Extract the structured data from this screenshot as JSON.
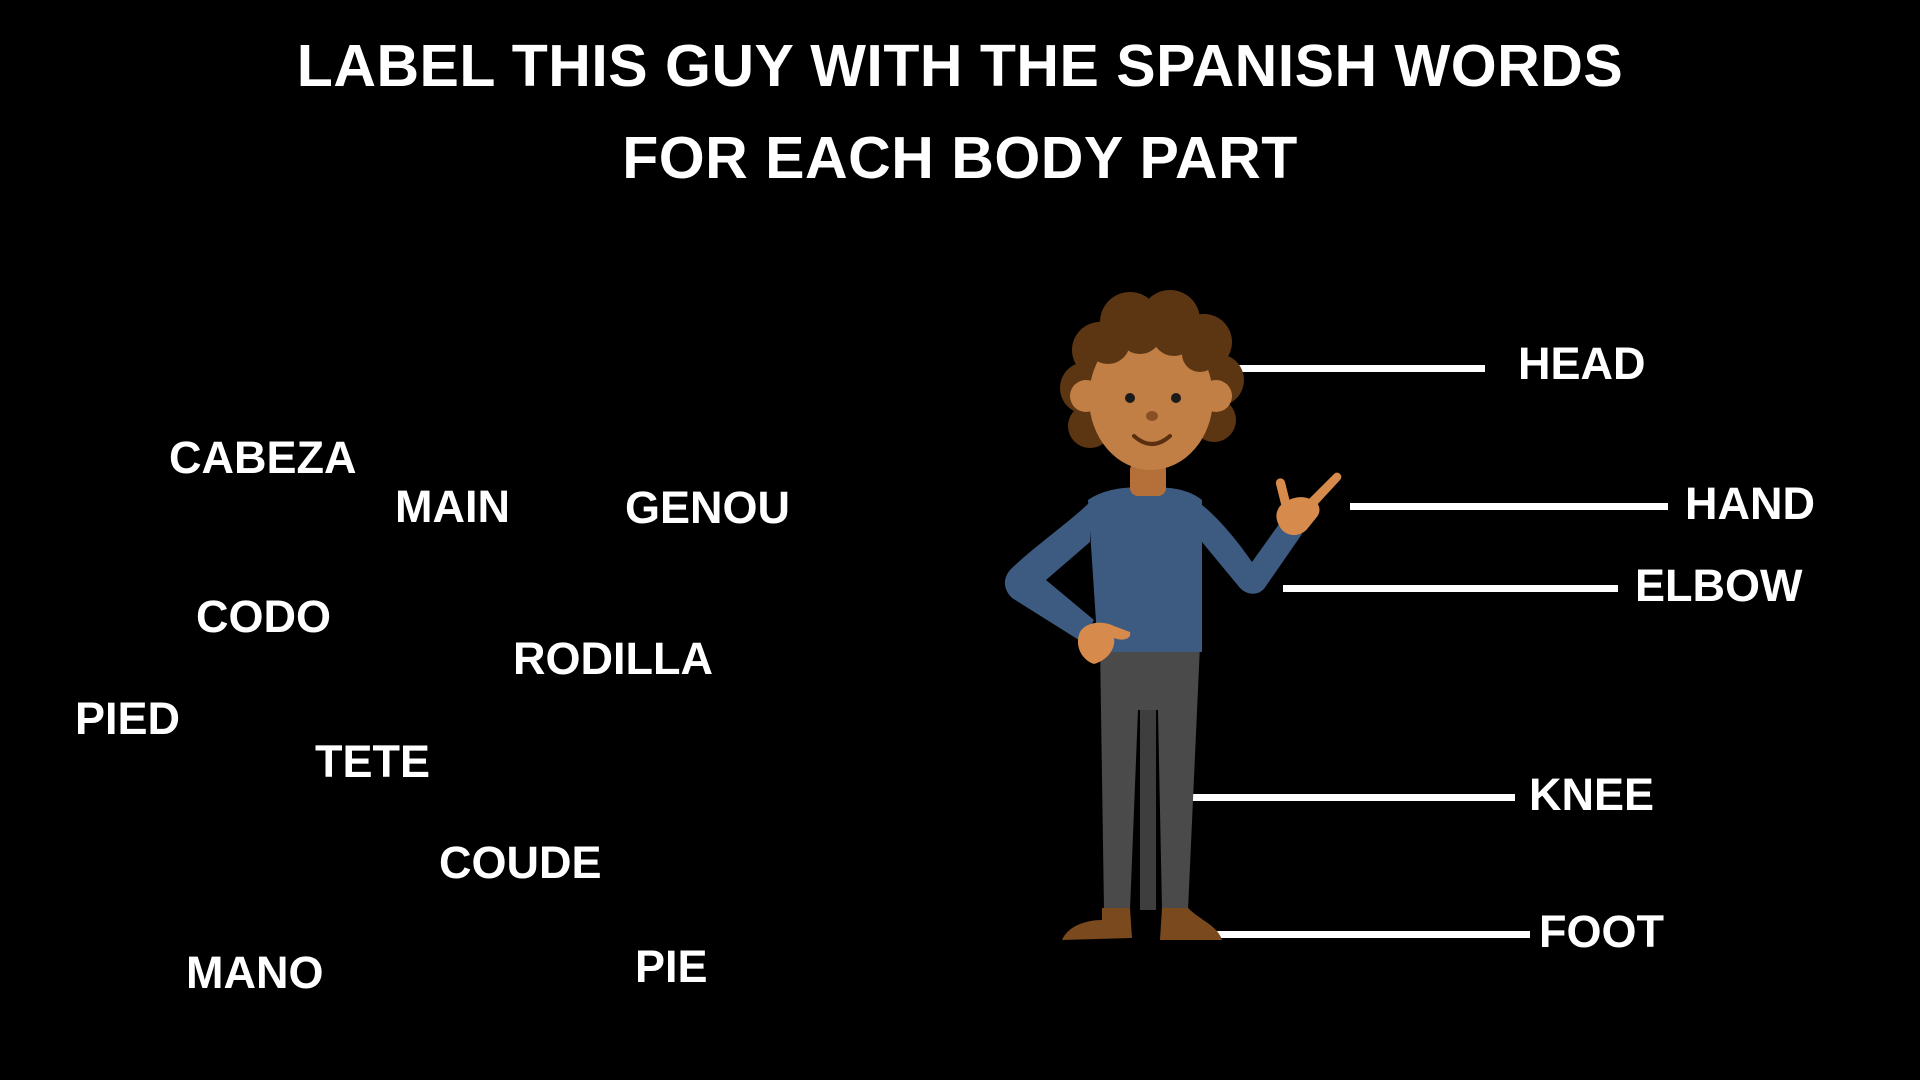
{
  "title": {
    "line1": "LABEL THIS GUY WITH THE SPANISH WORDS",
    "line2": "FOR EACH BODY PART"
  },
  "word_bank": [
    "CABEZA",
    "MAIN",
    "GENOU",
    "CODO",
    "RODILLA",
    "PIED",
    "TETE",
    "COUDE",
    "MANO",
    "PIE"
  ],
  "body_labels": {
    "head": "HEAD",
    "hand": "HAND",
    "elbow": "ELBOW",
    "knee": "KNEE",
    "foot": "FOOT"
  },
  "colors": {
    "background": "#000000",
    "text": "#ffffff",
    "shirt": "#3d5a80",
    "pants": "#4a4a4a",
    "skin": "#c17f45",
    "hair": "#5c3613",
    "shoes": "#7a4a1e"
  }
}
